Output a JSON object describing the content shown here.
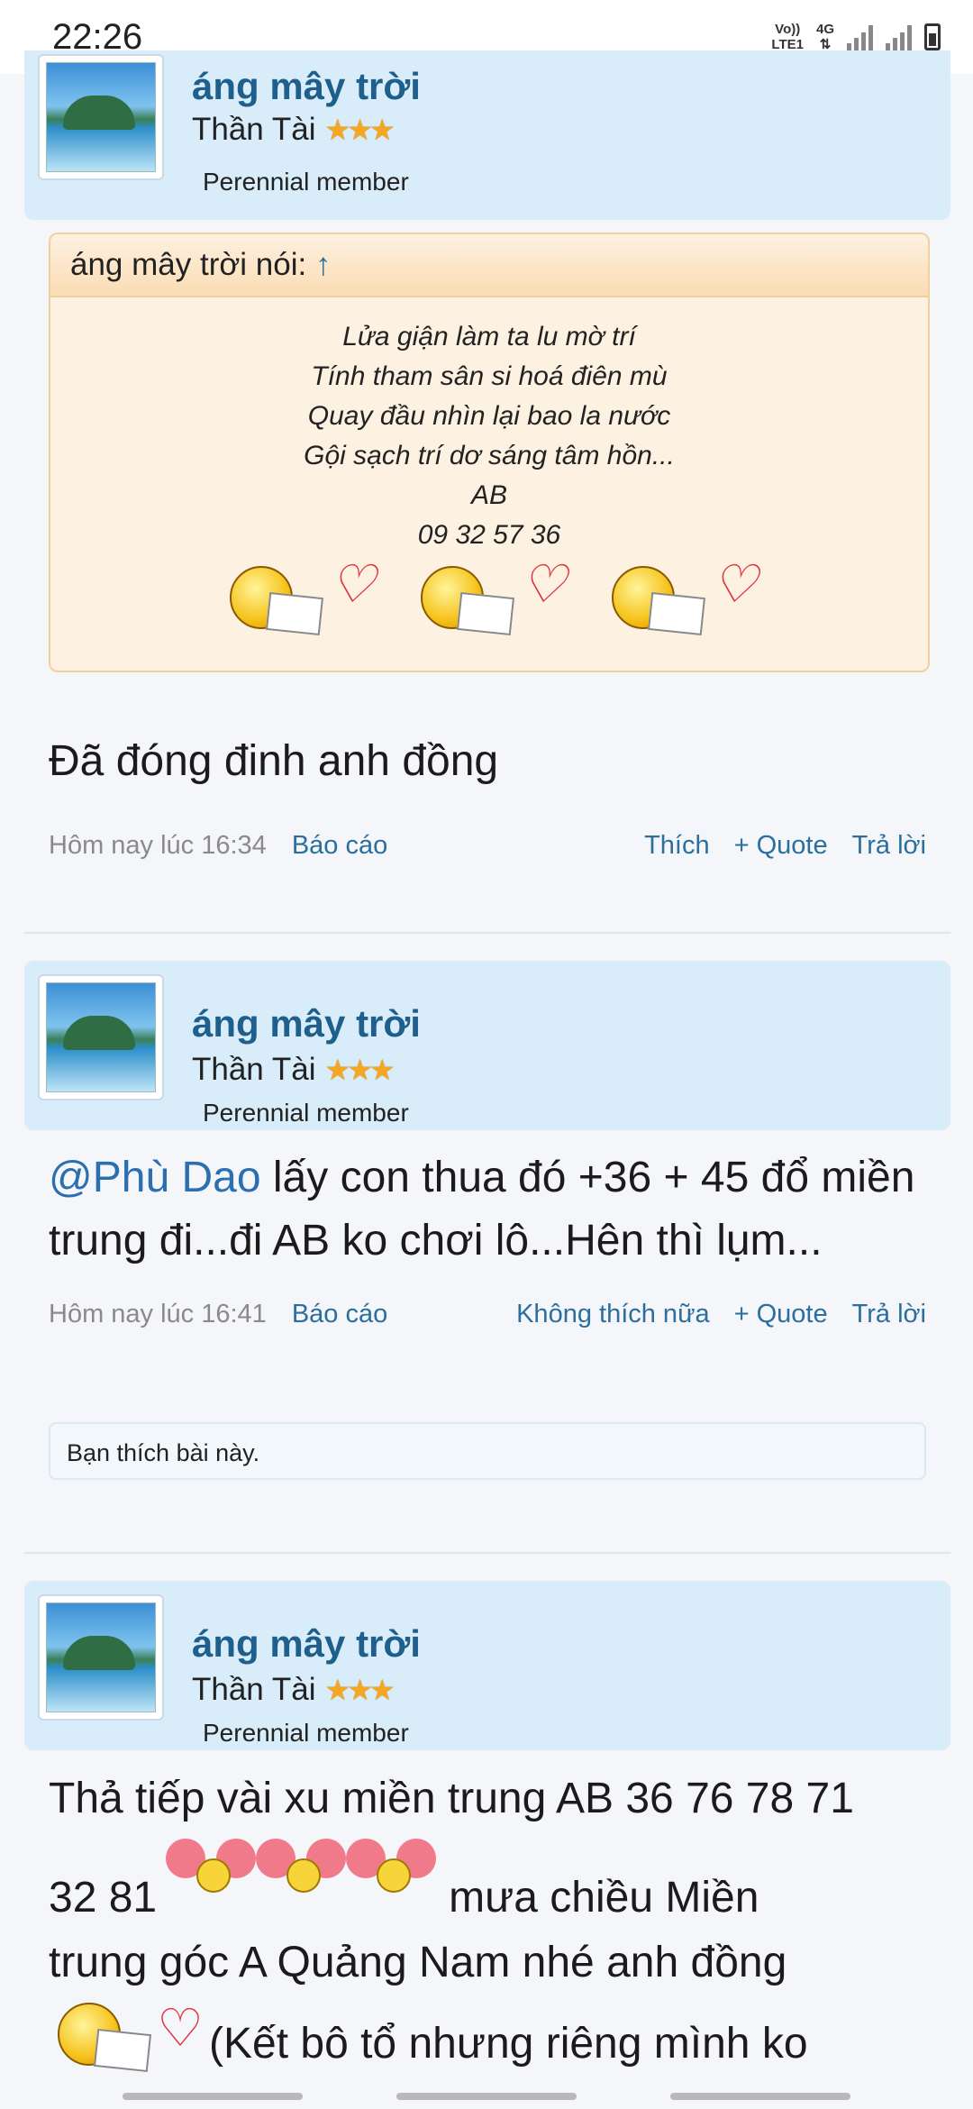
{
  "status_bar": {
    "time": "22:26",
    "net_top": "Vo))",
    "net_bottom": "LTE1",
    "net_type": "4G"
  },
  "posts": [
    {
      "username": "áng mây trời",
      "rank": "Thần Tài",
      "member": "Perennial member",
      "quote": {
        "author_line": "áng mây trời nói:",
        "arrow": "↑",
        "lines": [
          "Lửa giận làm ta lu mờ trí",
          "Tính tham sân si hoá điên mù",
          "Quay đầu nhìn lại bao la nước",
          "Gội sạch trí dơ sáng tâm hồn...",
          "AB",
          "09 32 57 36"
        ]
      },
      "body": "Đã đóng đinh anh đồng",
      "date": "Hôm nay lúc 16:34",
      "report": "Báo cáo",
      "actions": [
        "Thích",
        "+ Quote",
        "Trả lời"
      ]
    },
    {
      "username": "áng mây trời",
      "rank": "Thần Tài",
      "member": "Perennial member",
      "mention": "@Phù Dao",
      "body": " lấy con thua đó +36 + 45 đổ miền trung đi...đi AB ko chơi lô...Hên thì lụm...",
      "date": "Hôm nay lúc 16:41",
      "report": "Báo cáo",
      "actions": [
        "Không thích nữa",
        "+ Quote",
        "Trả lời"
      ],
      "liked": "Bạn thích bài này."
    },
    {
      "username": "áng mây trời",
      "rank": "Thần Tài",
      "member": "Perennial member",
      "body_1": "Thả tiếp vài xu miền trung AB 36 76 78 71",
      "body_2": "32 81",
      "body_3": "mưa chiều Miền",
      "body_4": "trung góc A Quảng Nam nhé anh đồng",
      "body_5": "(Kết bô tổ nhưng riêng mình ko"
    }
  ],
  "colors": {
    "header_bg": "#d8ecfa",
    "link": "#2a6f9e",
    "quote_bg": "#fdf1e1"
  }
}
